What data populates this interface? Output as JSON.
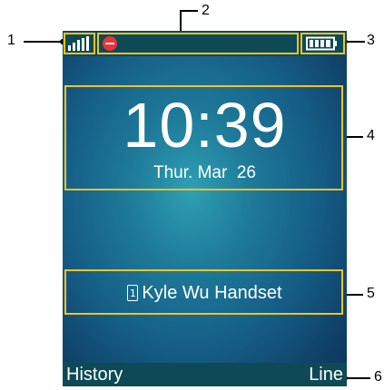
{
  "callouts": [
    "1",
    "2",
    "3",
    "4",
    "5",
    "6"
  ],
  "status_bar": {
    "signal_icon": "signal-strength-icon",
    "status_icon": "do-not-disturb-icon",
    "battery_icon": "battery-full-icon",
    "accent": "#f2c227",
    "stop_color": "#e8333a"
  },
  "idle_screen": {
    "time": "10:39",
    "date": "Thur. Mar  26"
  },
  "handset": {
    "icon": "handset-1-icon",
    "icon_number": "1",
    "name": "Kyle Wu Handset"
  },
  "softkeys": {
    "left": "History",
    "right": "Line"
  }
}
